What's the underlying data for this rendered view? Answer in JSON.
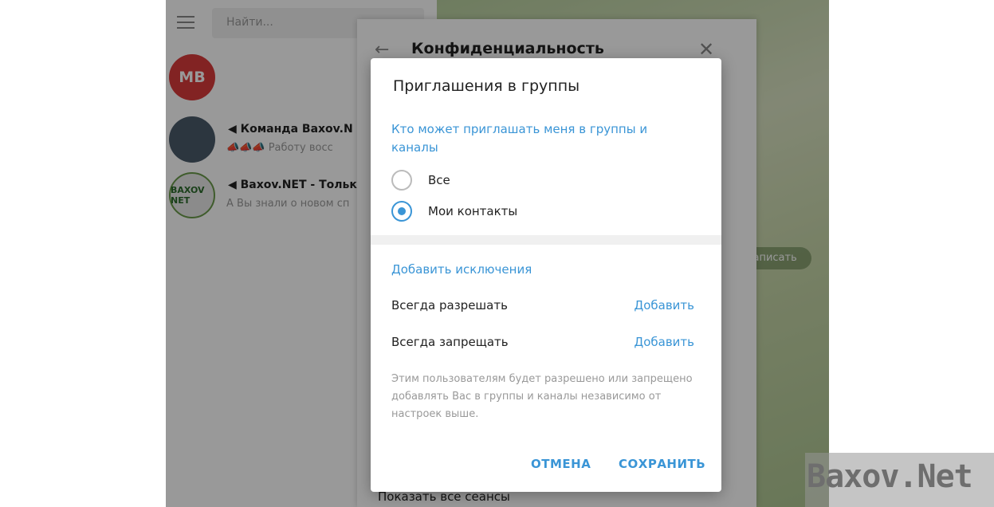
{
  "search": {
    "placeholder": "Найти..."
  },
  "chats": [
    {
      "initials": "MB",
      "name": "",
      "message": "",
      "color": "#d93b3b"
    },
    {
      "name": "Команда Baxov.N",
      "message": "Работу восс",
      "prefix": "📣📣📣"
    },
    {
      "name": "Baxov.NET - Тольк",
      "message": "А Вы знали о новом сп",
      "avatar_text": "BAXOV NET"
    }
  ],
  "right_panel": {
    "write_button": "написать"
  },
  "settings": {
    "title": "Конфиденциальность",
    "sessions_link": "Показать все сеансы"
  },
  "dialog": {
    "title": "Приглашения в группы",
    "section_title": "Кто может приглашать меня в группы и каналы",
    "options": [
      {
        "label": "Все",
        "selected": false
      },
      {
        "label": "Мои контакты",
        "selected": true
      }
    ],
    "exceptions_title": "Добавить исключения",
    "always_allow": "Всегда разрешать",
    "always_deny": "Всегда запрещать",
    "add_label": "Добавить",
    "note": "Этим пользователям будет разрешено или запрещено добавлять Вас в группы и каналы независимо от настроек выше.",
    "cancel": "ОТМЕНА",
    "save": "СОХРАНИТЬ"
  },
  "watermark": "Baxov.Net",
  "colors": {
    "accent": "#3a95d6"
  }
}
